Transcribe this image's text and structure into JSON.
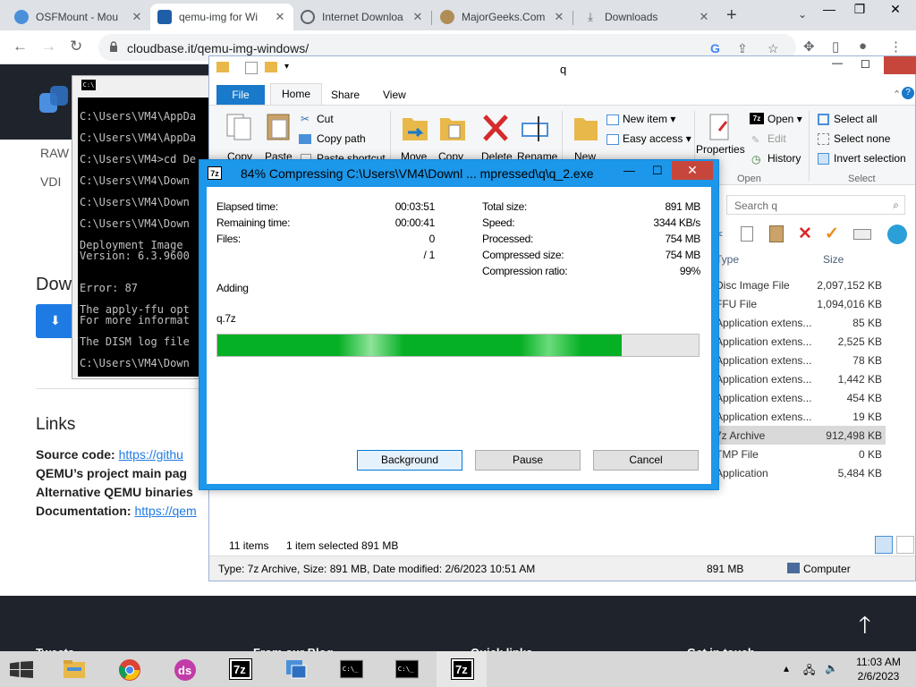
{
  "browser": {
    "tabs": [
      {
        "label": "OSFMount - Mou",
        "favicon_color": "#4a90d9"
      },
      {
        "label": "qemu-img for Wi",
        "favicon_color": "#1f5fa8"
      },
      {
        "label": "Internet Downloa",
        "favicon_color": "#5f6368"
      },
      {
        "label": "MajorGeeks.Com",
        "favicon_color": "#8a6d3b"
      },
      {
        "label": "Downloads",
        "favicon_color": "#5f6368"
      }
    ],
    "url": "cloudbase.it/qemu-img-windows/"
  },
  "webpage": {
    "raw_label": "RAW",
    "vdi_label": "VDI",
    "download_heading": "Dow",
    "links_heading": "Links",
    "source_code_label": "Source code:",
    "source_code_link": "https://githu",
    "qemu_main_label": "QEMU’s project main pag",
    "alt_binaries_label": "Alternative QEMU binaries",
    "documentation_label": "Documentation:",
    "documentation_link": "https://qem",
    "footer": [
      "Tweets",
      "From our Blog",
      "Quick links",
      "Get in touch"
    ]
  },
  "cmd": {
    "lines": [
      "C:\\Users\\VM4\\AppDa",
      "C:\\Users\\VM4\\AppDa",
      "C:\\Users\\VM4>cd De",
      "C:\\Users\\VM4\\Down",
      "C:\\Users\\VM4\\Down",
      "C:\\Users\\VM4\\Down",
      "Deployment Image",
      "Version: 6.3.9600",
      "Error: 87",
      "The apply-ffu opt",
      "For more informat",
      "The DISM log file",
      "C:\\Users\\VM4\\Down"
    ]
  },
  "explorer": {
    "title": "q",
    "ribbon_tabs": {
      "file": "File",
      "home": "Home",
      "share": "Share",
      "view": "View"
    },
    "ribbon": {
      "copy": "Copy",
      "paste": "Paste",
      "cut": "Cut",
      "copy_path": "Copy path",
      "paste_shortcut": "Paste shortcut",
      "move_to": "Move",
      "copy_to": "Copy",
      "delete": "Delete",
      "rename": "Rename",
      "new_folder": "New",
      "new_item": "New item",
      "easy_access": "Easy access",
      "properties": "Properties",
      "open": "Open",
      "edit": "Edit",
      "history": "History",
      "select_all": "Select all",
      "select_none": "Select none",
      "invert_selection": "Invert selection",
      "group_open": "Open",
      "group_select": "Select"
    },
    "search_placeholder": "Search q",
    "columns": {
      "type": "Type",
      "size": "Size"
    },
    "files": [
      {
        "type": "Disc Image File",
        "size": "2,097,152 KB"
      },
      {
        "type": "FFU File",
        "size": "1,094,016 KB"
      },
      {
        "type": "Application extens...",
        "size": "85 KB"
      },
      {
        "type": "Application extens...",
        "size": "2,525 KB"
      },
      {
        "type": "Application extens...",
        "size": "78 KB"
      },
      {
        "type": "Application extens...",
        "size": "1,442 KB"
      },
      {
        "type": "Application extens...",
        "size": "454 KB"
      },
      {
        "type": "Application extens...",
        "size": "19 KB"
      },
      {
        "type": "7z Archive",
        "size": "912,498 KB"
      },
      {
        "type": "TMP File",
        "size": "0 KB"
      },
      {
        "type": "Application",
        "size": "5,484 KB"
      }
    ],
    "status": {
      "items": "11 items",
      "selected": "1 item selected  891 MB"
    },
    "details": {
      "info": "Type: 7z Archive, Size: 891 MB, Date modified: 2/6/2023 10:51 AM",
      "size": "891 MB",
      "location": "Computer"
    }
  },
  "dialog": {
    "title": "84% Compressing C:\\Users\\VM4\\Downl ... mpressed\\q\\q_2.exe",
    "elapsed_label": "Elapsed time:",
    "elapsed": "00:03:51",
    "remaining_label": "Remaining time:",
    "remaining": "00:00:41",
    "files_label": "Files:",
    "files": "0",
    "files_total": "/ 1",
    "total_size_label": "Total size:",
    "total_size": "891 MB",
    "speed_label": "Speed:",
    "speed": "3344 KB/s",
    "processed_label": "Processed:",
    "processed": "754 MB",
    "compressed_label": "Compressed size:",
    "compressed": "754 MB",
    "ratio_label": "Compression ratio:",
    "ratio": "99%",
    "action": "Adding",
    "current_file": "q.7z",
    "progress": 0.84,
    "buttons": {
      "background": "Background",
      "pause": "Pause",
      "cancel": "Cancel"
    }
  },
  "taskbar": {
    "time": "11:03 AM",
    "date": "2/6/2023"
  }
}
